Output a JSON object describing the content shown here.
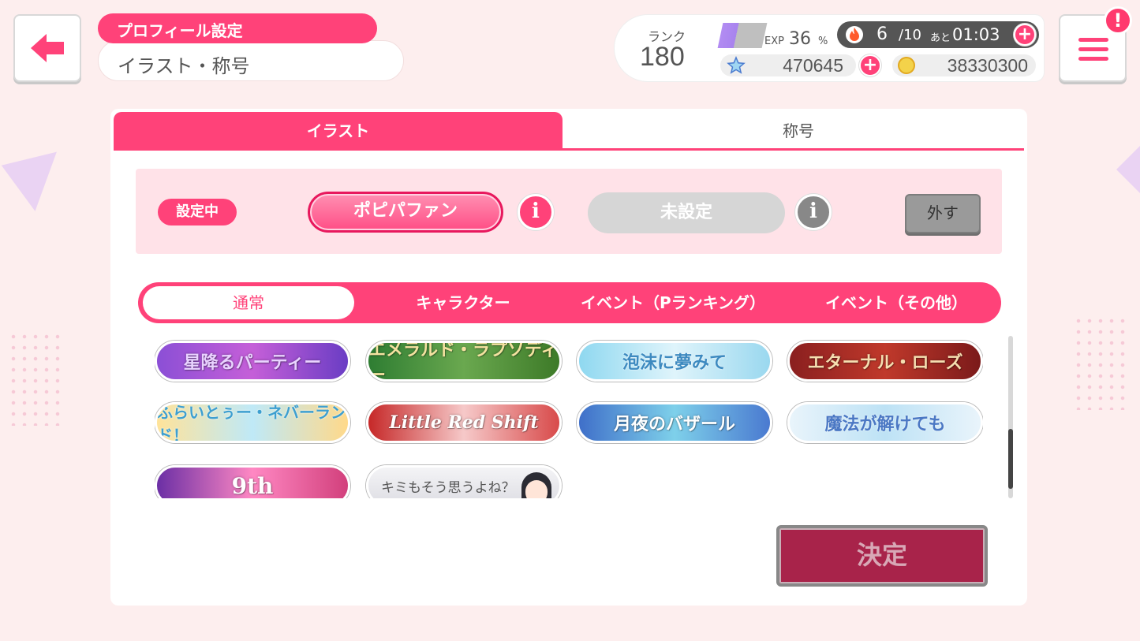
{
  "header": {
    "category": "プロフィール設定",
    "title": "イラスト・称号"
  },
  "status": {
    "rank_label": "ランク",
    "rank": "180",
    "exp_label": "EXP",
    "exp_value": "36",
    "exp_unit": "%",
    "exp_fraction": 0.36,
    "live_current": "6",
    "live_max": "/10",
    "live_ato": "あと",
    "live_time": "01:03",
    "stars": "470645",
    "coins": "38330300",
    "plus_symbol": "+",
    "notification": "!"
  },
  "tabs": {
    "illust": "イラスト",
    "title": "称号"
  },
  "setting": {
    "label": "設定中",
    "current": "ポピパファン",
    "unset": "未設定",
    "info": "i",
    "remove": "外す"
  },
  "categories": {
    "normal": "通常",
    "character": "キャラクター",
    "event_p": "イベント（Pランキング）",
    "event_other": "イベント（その他）"
  },
  "plates": [
    "星降るパーティー",
    "エメラルド・ラプソディー",
    "泡沫に夢みて",
    "エターナル・ローズ",
    "ふらいとぅー・ネバーランド！",
    "Little Red Shift",
    "月夜のバザール",
    "魔法が解けても",
    "9th",
    "キミもそう思うよね？"
  ],
  "decide": "決定",
  "colors": {
    "accent": "#ff4279",
    "background": "#fdeeee",
    "decide": "#a8234a"
  },
  "icons": [
    "back-arrow-icon",
    "menu-icon",
    "fire-icon",
    "star-icon",
    "coin-icon",
    "info-icon"
  ]
}
